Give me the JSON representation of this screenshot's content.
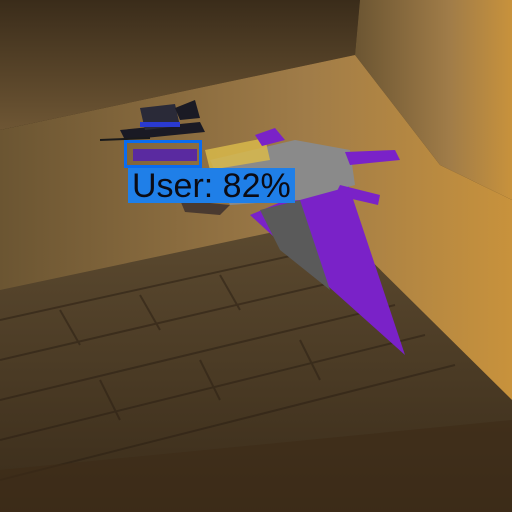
{
  "detection": {
    "label": "User: 82%",
    "box_color": "#0a6cf0",
    "label_bg_color": "#1f7fe8"
  },
  "scene": {
    "wall_color": "#8a6a3c",
    "floor_color": "#4a3c28",
    "character_color": "#7a22c8"
  }
}
